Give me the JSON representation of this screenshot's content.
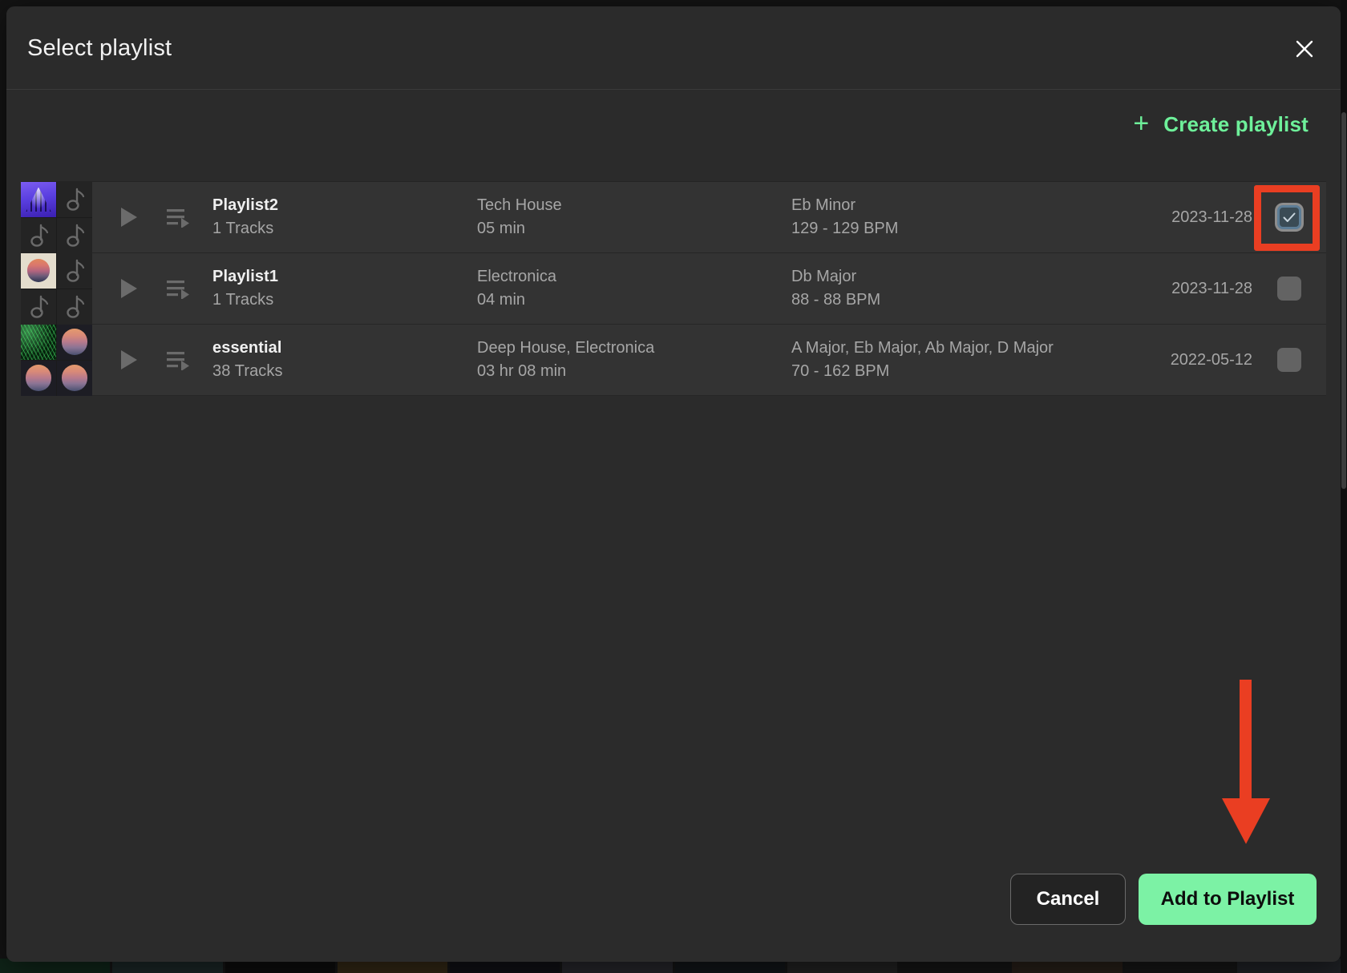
{
  "modal": {
    "title": "Select playlist",
    "close_icon": "close-icon"
  },
  "toolbar": {
    "create_playlist_label": "Create playlist",
    "plus_icon": "plus-icon",
    "accent_color": "#6ef09a"
  },
  "list": {
    "rows": [
      {
        "name": "Playlist2",
        "tracks": "1 Tracks",
        "genre": "Tech House",
        "duration": "05 min",
        "key": "Eb Minor",
        "bpm": "129 - 129 BPM",
        "date": "2023-11-28",
        "checked": true,
        "art": [
          "purple",
          "note",
          "note",
          "note"
        ]
      },
      {
        "name": "Playlist1",
        "tracks": "1 Tracks",
        "genre": "Electronica",
        "duration": "04 min",
        "key": "Db Major",
        "bpm": "88 - 88 BPM",
        "date": "2023-11-28",
        "checked": false,
        "art": [
          "cream",
          "note",
          "note",
          "note"
        ]
      },
      {
        "name": "essential",
        "tracks": "38 Tracks",
        "genre": "Deep House, Electronica",
        "duration": "03 hr 08 min",
        "key": "A Major, Eb Major, Ab Major, D Major",
        "bpm": "70 - 162 BPM",
        "date": "2022-05-12",
        "checked": false,
        "art": [
          "green",
          "sunset",
          "sunset",
          "sunset"
        ]
      }
    ],
    "play_icon": "play-icon",
    "queue_icon": "add-to-queue-icon",
    "checkbox_icon": "checkmark-icon"
  },
  "footer": {
    "cancel_label": "Cancel",
    "add_label": "Add to Playlist",
    "add_button_color": "#7cf2a5"
  },
  "annotations": {
    "highlight_color": "#ea3e22",
    "arrow_icon": "down-arrow-annotation",
    "box_icon": "highlight-box-annotation"
  }
}
